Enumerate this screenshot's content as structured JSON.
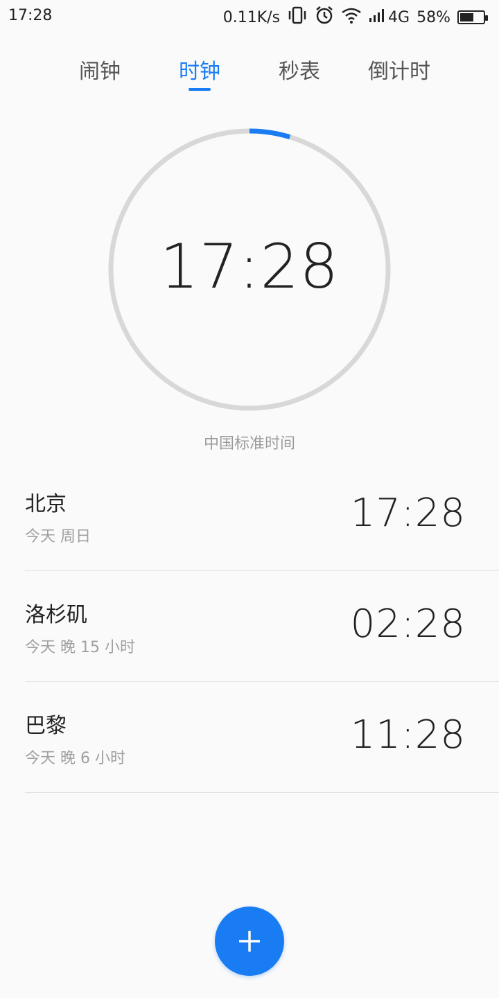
{
  "status_bar": {
    "time": "17:28",
    "net_speed": "0.11K/s",
    "network": "4G",
    "battery": "58%",
    "battery_level": 0.58,
    "icons": [
      "vibrate-icon",
      "alarm-icon",
      "wifi-icon",
      "signal-icon",
      "battery-icon"
    ]
  },
  "tabs": [
    {
      "label": "闹钟",
      "active": false
    },
    {
      "label": "时钟",
      "active": true
    },
    {
      "label": "秒表",
      "active": false
    },
    {
      "label": "倒计时",
      "active": false
    }
  ],
  "main_clock": {
    "time": "17:28",
    "timezone_label": "中国标准时间",
    "seconds_progress": 0.047
  },
  "cities": [
    {
      "name": "北京",
      "sub": "今天  周日",
      "time": "17:28"
    },
    {
      "name": "洛杉矶",
      "sub": "今天  晚 15 小时",
      "time": "02:28"
    },
    {
      "name": "巴黎",
      "sub": "今天  晚 6 小时",
      "time": "11:28"
    }
  ],
  "fab": {
    "icon": "plus-icon"
  },
  "colors": {
    "accent": "#1a7cf2",
    "ring": "#d8d8d8",
    "text": "#222222",
    "muted": "#a0a0a0"
  }
}
